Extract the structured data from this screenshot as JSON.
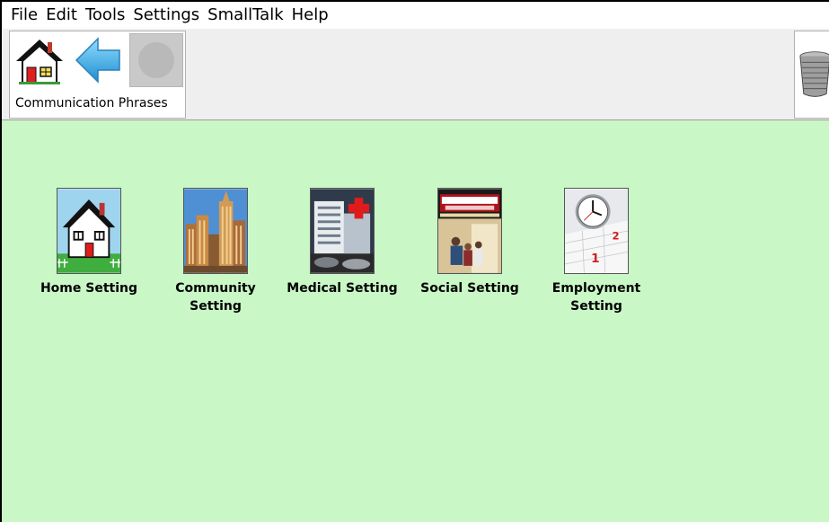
{
  "menu": {
    "items": [
      "File",
      "Edit",
      "Tools",
      "Settings",
      "SmallTalk",
      "Help"
    ]
  },
  "toolbar": {
    "breadcrumb": "Communication Phrases",
    "home_icon": "house-icon",
    "back_icon": "back-arrow-icon",
    "forward_icon": "forward-disabled-icon",
    "trash_icon": "wastebasket-icon"
  },
  "colors": {
    "background": "#c9f7c6",
    "toolbar": "#efefef",
    "back_arrow": "#3fb3e8"
  },
  "tiles": [
    {
      "label": "Home Setting",
      "icon": "house-icon"
    },
    {
      "label": "Community Setting",
      "icon": "city-buildings-icon"
    },
    {
      "label": "Medical Setting",
      "icon": "hospital-icon"
    },
    {
      "label": "Social Setting",
      "icon": "theater-icon"
    },
    {
      "label": "Employment Setting",
      "icon": "clock-calendar-icon"
    }
  ]
}
